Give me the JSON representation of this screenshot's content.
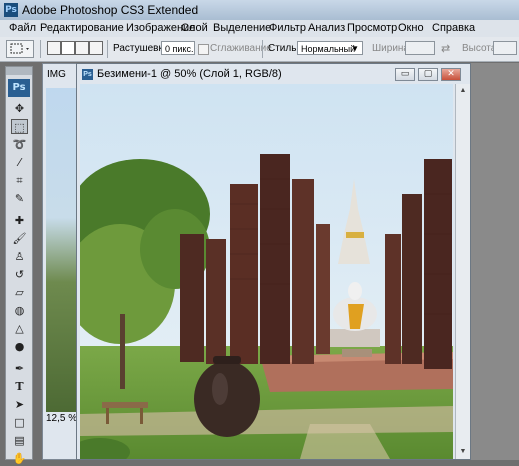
{
  "app": {
    "logo": "Ps",
    "title": "Adobe Photoshop CS3 Extended"
  },
  "menu": [
    "Файл",
    "Редактирование",
    "Изображение",
    "Слой",
    "Выделение",
    "Фильтр",
    "Анализ",
    "Просмотр",
    "Окно",
    "Справка"
  ],
  "options": {
    "feather_label": "Растушевка:",
    "feather_value": "0 пикс.",
    "antialias_label": "Сглаживание",
    "style_label": "Стиль:",
    "style_value": "Нормальный",
    "width_label": "Ширина:",
    "height_label": "Высота:"
  },
  "toolbox": {
    "logo": "Ps"
  },
  "background_doc": {
    "title": "IMG",
    "zoom": "12,5 %"
  },
  "document": {
    "icon": "Ps",
    "title": "Безимени-1 @ 50% (Слой 1, RGB/8)",
    "image_desc_colors": {
      "sky": "#cfe3f2",
      "brick": "#5a2e24",
      "grass": "#6d9a3c",
      "stone": "#b0705c"
    }
  },
  "window_buttons": {
    "minimize": "▭",
    "maximize": "▢",
    "close": "✕"
  }
}
